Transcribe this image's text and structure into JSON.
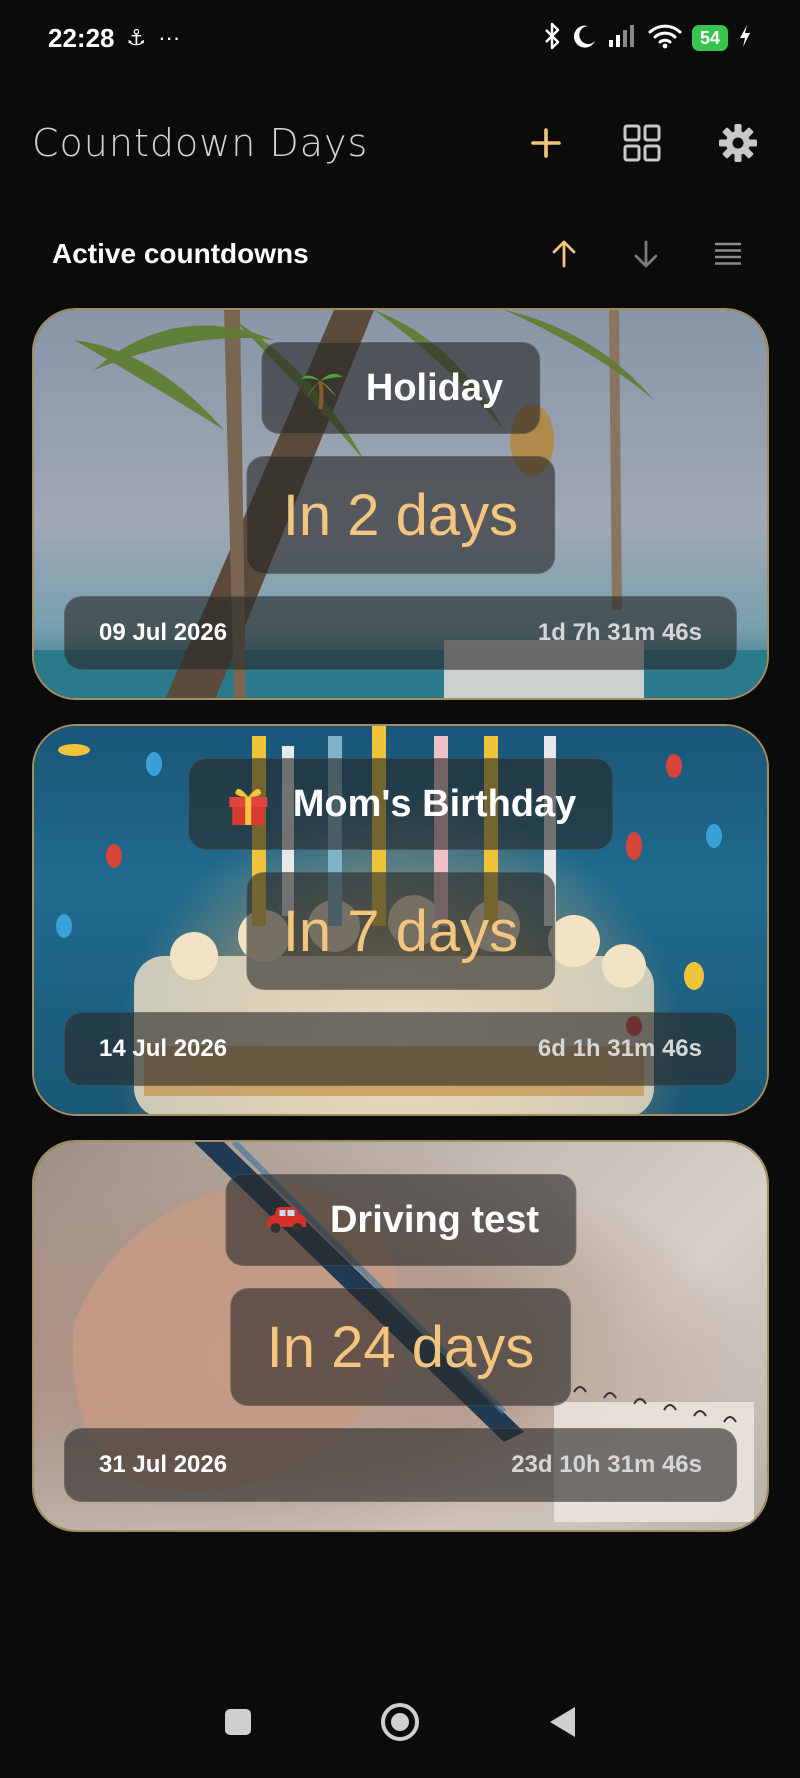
{
  "status_bar": {
    "time": "22:28",
    "extra_icon": "anchor-icon",
    "more": "···",
    "battery": "54",
    "icons": [
      "bluetooth-icon",
      "moon-icon",
      "signal-icon",
      "wifi-icon",
      "battery-icon",
      "charging-icon"
    ]
  },
  "app_bar": {
    "title": "Countdown Days",
    "actions": [
      "add-icon",
      "grid-icon",
      "gear-icon"
    ],
    "accent_color": "#f3c57e"
  },
  "section": {
    "title": "Active countdowns",
    "sort_icons": [
      "arrow-up-icon",
      "arrow-down-icon",
      "list-icon"
    ]
  },
  "countdowns": [
    {
      "emoji": "🌴",
      "name": "Holiday",
      "countdown": "In 2 days",
      "date": "09 Jul 2026",
      "remaining": "1d 7h 31m 46s",
      "background": "beach-palms"
    },
    {
      "emoji": "🎁",
      "name": "Mom's Birthday",
      "countdown": "In 7 days",
      "date": "14 Jul 2026",
      "remaining": "6d 1h 31m 46s",
      "background": "birthday-cake"
    },
    {
      "emoji": "🚗",
      "name": "Driving test",
      "countdown": "In 24 days",
      "date": "31 Jul 2026",
      "remaining": "23d 10h 31m 46s",
      "background": "hand-writing"
    }
  ],
  "nav_bar": [
    "recents-icon",
    "home-icon",
    "back-icon"
  ]
}
